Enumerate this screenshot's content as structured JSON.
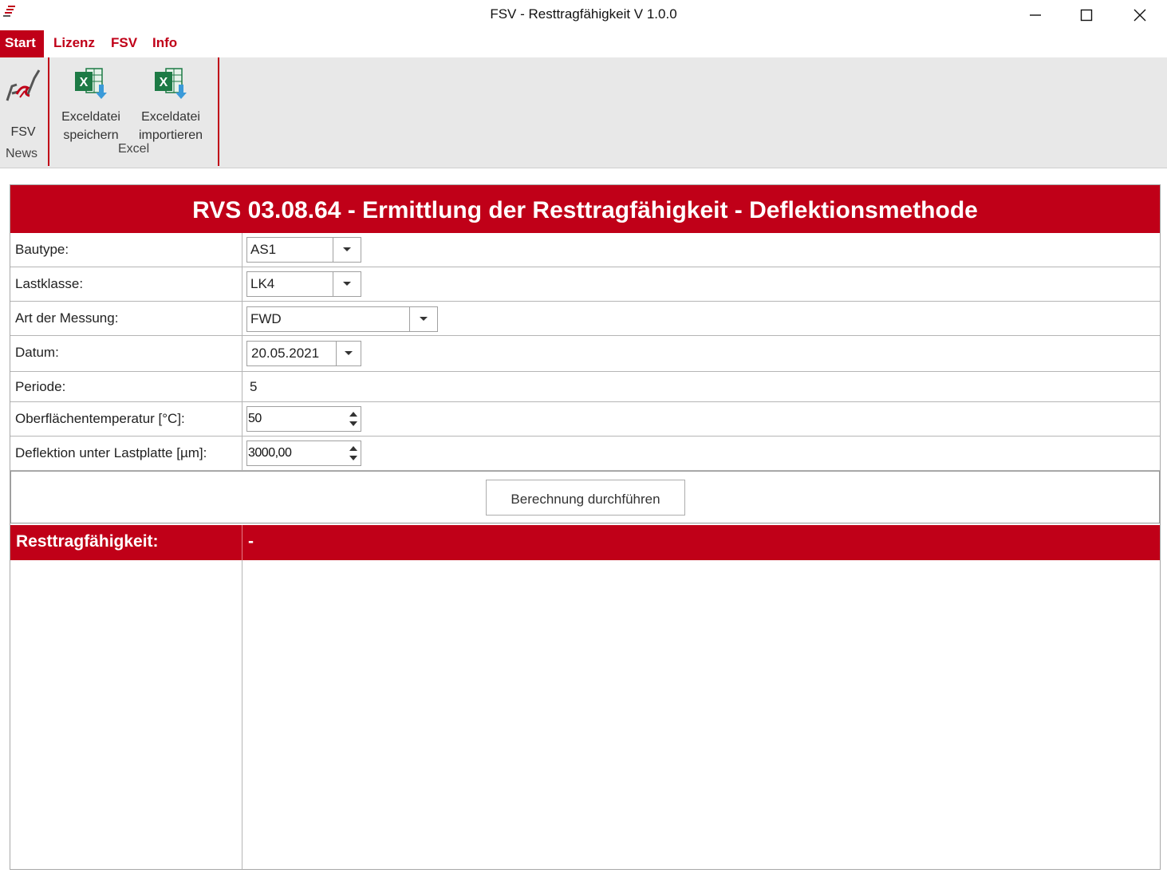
{
  "window": {
    "title": "FSV - Resttragfähigkeit V 1.0.0",
    "minimize_icon": "minimize-icon",
    "maximize_icon": "maximize-icon",
    "close_icon": "close-icon"
  },
  "ribbon": {
    "tabs": [
      {
        "label": "Start",
        "active": true
      },
      {
        "label": "Lizenz",
        "active": false
      },
      {
        "label": "FSV",
        "active": false
      },
      {
        "label": "Info",
        "active": false
      }
    ],
    "groups": {
      "news": {
        "label": "News",
        "buttons": [
          {
            "label": "FSV",
            "icon": "fsv-logo-icon"
          }
        ]
      },
      "excel": {
        "label": "Excel",
        "buttons": [
          {
            "label_line1": "Exceldatei",
            "label_line2": "speichern",
            "icon": "excel-export-icon"
          },
          {
            "label_line1": "Exceldatei",
            "label_line2": "importieren",
            "icon": "excel-import-icon"
          }
        ]
      }
    }
  },
  "form": {
    "title": "RVS 03.08.64 - Ermittlung der Resttragfähigkeit - Deflektionsmethode",
    "fields": {
      "bautype": {
        "label": "Bautype:",
        "value": "AS1"
      },
      "lastklasse": {
        "label": "Lastklasse:",
        "value": "LK4"
      },
      "messung": {
        "label": "Art der Messung:",
        "value": "FWD"
      },
      "datum": {
        "label": "Datum:",
        "value": "20.05.2021"
      },
      "periode": {
        "label": "Periode:",
        "value": "5"
      },
      "temperatur": {
        "label": "Oberflächentemperatur [°C]:",
        "value": "50"
      },
      "deflektion": {
        "label": "Deflektion unter Lastplatte [µm]:",
        "value": "3000,00"
      }
    },
    "calculate_label": "Berechnung durchführen",
    "result": {
      "label": "Resttragfähigkeit:",
      "value": "-"
    }
  },
  "colors": {
    "accent": "#c00018",
    "ribbon_bg": "#e8e8e8",
    "excel_green": "#1d7a45"
  }
}
